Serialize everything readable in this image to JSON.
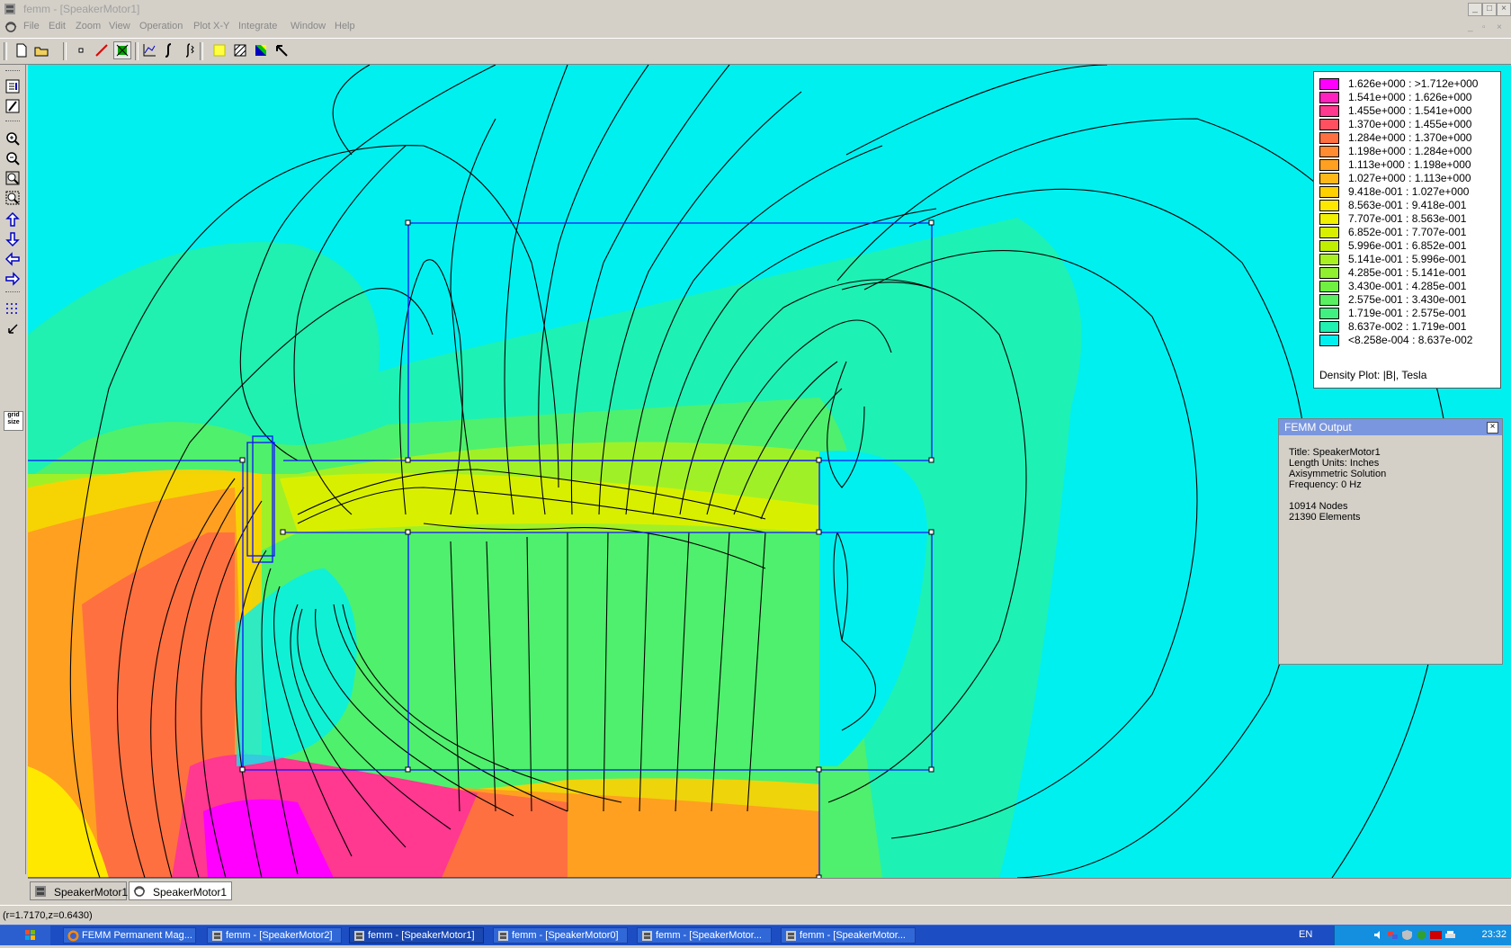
{
  "window": {
    "title": "femm - [SpeakerMotor1]"
  },
  "menu": [
    "File",
    "Edit",
    "Zoom",
    "View",
    "Operation",
    "Plot X-Y",
    "Integrate",
    "Window",
    "Help"
  ],
  "toolbar": {
    "buttons": [
      "new-file-icon",
      "open-folder-icon",
      "point-mode-icon",
      "contour-mode-icon",
      "area-mode-icon",
      "plot-xy-icon",
      "line-integral-icon",
      "block-integral-icon",
      "density-plot-icon",
      "vector-plot-icon",
      "contour-plot-icon",
      "select-arrow-icon"
    ]
  },
  "left_toolbar": {
    "buttons": [
      "show-mesh-icon",
      "edit-icon",
      "zoom-in-icon",
      "zoom-out-icon",
      "zoom-natural-icon",
      "zoom-window-icon",
      "pan-up-icon",
      "pan-down-icon",
      "pan-left-icon",
      "pan-right-icon",
      "show-grid-icon",
      "snap-grid-icon"
    ],
    "grid_size_label": "grid size"
  },
  "legend": {
    "entries": [
      {
        "label": "1.626e+000 : >1.712e+000",
        "color": "#ff00ff"
      },
      {
        "label": "1.541e+000 : 1.626e+000",
        "color": "#ff20c0"
      },
      {
        "label": "1.455e+000 : 1.541e+000",
        "color": "#ff3890"
      },
      {
        "label": "1.370e+000 : 1.455e+000",
        "color": "#ff5060"
      },
      {
        "label": "1.284e+000 : 1.370e+000",
        "color": "#ff7040"
      },
      {
        "label": "1.198e+000 : 1.284e+000",
        "color": "#ff8c30"
      },
      {
        "label": "1.113e+000 : 1.198e+000",
        "color": "#ffa020"
      },
      {
        "label": "1.027e+000 : 1.113e+000",
        "color": "#ffb818"
      },
      {
        "label": "9.418e-001 : 1.027e+000",
        "color": "#ffd000"
      },
      {
        "label": "8.563e-001 : 9.418e-001",
        "color": "#ffe800"
      },
      {
        "label": "7.707e-001 : 8.563e-001",
        "color": "#f0f000"
      },
      {
        "label": "6.852e-001 : 7.707e-001",
        "color": "#d8f000"
      },
      {
        "label": "5.996e-001 : 6.852e-001",
        "color": "#c0f000"
      },
      {
        "label": "5.141e-001 : 5.996e-001",
        "color": "#a8f020"
      },
      {
        "label": "4.285e-001 : 5.141e-001",
        "color": "#90f030"
      },
      {
        "label": "3.430e-001 : 4.285e-001",
        "color": "#70f040"
      },
      {
        "label": "2.575e-001 : 3.430e-001",
        "color": "#58f060"
      },
      {
        "label": "1.719e-001 : 2.575e-001",
        "color": "#40f080"
      },
      {
        "label": "8.637e-002 : 1.719e-001",
        "color": "#20f0b0"
      },
      {
        "label": "<8.258e-004 : 8.637e-002",
        "color": "#00f0f0"
      }
    ],
    "caption": "Density Plot: |B|, Tesla"
  },
  "output": {
    "title": "FEMM Output",
    "lines": [
      "Title: SpeakerMotor1",
      "Length Units: Inches",
      "Axisymmetric Solution",
      "Frequency: 0 Hz",
      "",
      "10914 Nodes",
      "21390 Elements"
    ]
  },
  "doc_tabs": [
    {
      "label": "SpeakerMotor1",
      "icon": "preprocessor-doc-icon"
    },
    {
      "label": "SpeakerMotor1",
      "icon": "postprocessor-doc-icon"
    }
  ],
  "status": "(r=1.7170,z=0.6430)",
  "taskbar": {
    "items": [
      {
        "label": "FEMM Permanent Mag...",
        "icon": "firefox-icon"
      },
      {
        "label": "femm - [SpeakerMotor2]",
        "icon": "femm-icon"
      },
      {
        "label": "femm - [SpeakerMotor1]",
        "icon": "femm-icon"
      },
      {
        "label": "femm - [SpeakerMotor0]",
        "icon": "femm-icon"
      },
      {
        "label": "femm - [SpeakerMotor...",
        "icon": "femm-icon"
      },
      {
        "label": "femm - [SpeakerMotor...",
        "icon": "femm-icon"
      }
    ],
    "language": "EN",
    "clock": "23:32"
  },
  "colors": {
    "field_background": "#00f0f0",
    "geometry_lines": "#1010ff",
    "flux_lines": "#000000",
    "taskbar": "#1d4dc2"
  }
}
